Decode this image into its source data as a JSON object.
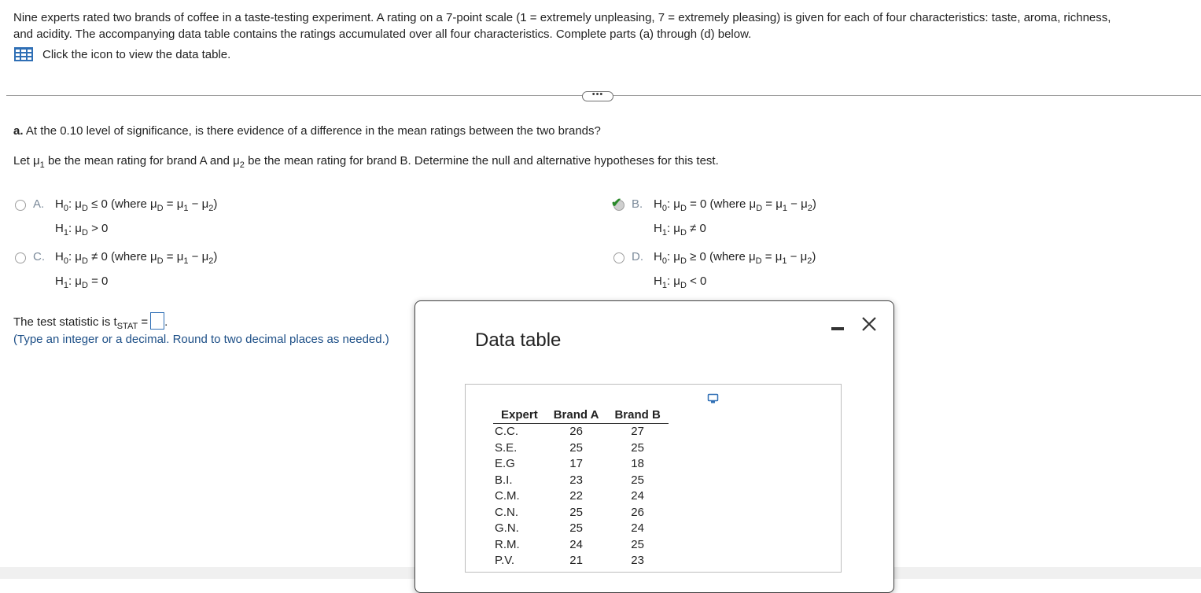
{
  "intro": {
    "line1": "Nine experts rated two brands of coffee in a taste-testing experiment. A rating on a 7-point scale (1 = extremely unpleasing, 7 = extremely pleasing) is given for each of four characteristics: taste, aroma, richness,",
    "line2": "and acidity. The accompanying data table contains the ratings accumulated over all four characteristics. Complete parts (a) through (d) below.",
    "link_text": "Click the icon to view the data table."
  },
  "more_button": "•••",
  "part_a": {
    "letter": "a.",
    "question": " At the 0.10 level of significance, is there evidence of a difference in the mean ratings between the two brands?",
    "let_line": {
      "t1": "Let μ",
      "s1": "1",
      "t2": " be the mean rating for brand A and μ",
      "s2": "2",
      "t3": " be the mean rating for brand B. Determine the null and alternative hypotheses for this test."
    },
    "options": [
      {
        "letter": "A.",
        "h0": "≤ 0",
        "h1": "> 0",
        "selected": false
      },
      {
        "letter": "B.",
        "h0": "= 0",
        "h1": "≠ 0",
        "selected": true
      },
      {
        "letter": "C.",
        "h0": "≠ 0",
        "h1": "= 0",
        "selected": false
      },
      {
        "letter": "D.",
        "h0": "≥ 0",
        "h1": "< 0",
        "selected": false
      }
    ],
    "where_text": " (where μ",
    "where_sub": "D",
    "where_rest": " = μ",
    "stat_label": "The test statistic is t",
    "stat_sub": "STAT",
    "stat_eq": " =",
    "stat_end": ".",
    "hint": "(Type an integer or a decimal. Round to two decimal places as needed.)"
  },
  "dialog": {
    "title": "Data table",
    "columns": [
      "Expert",
      "Brand A",
      "Brand B"
    ],
    "rows": [
      [
        "C.C.",
        "26",
        "27"
      ],
      [
        "S.E.",
        "25",
        "25"
      ],
      [
        "E.G",
        "17",
        "18"
      ],
      [
        "B.I.",
        "23",
        "25"
      ],
      [
        "C.M.",
        "22",
        "24"
      ],
      [
        "C.N.",
        "25",
        "26"
      ],
      [
        "G.N.",
        "25",
        "24"
      ],
      [
        "R.M.",
        "24",
        "25"
      ],
      [
        "P.V.",
        "21",
        "23"
      ]
    ]
  },
  "colors": {
    "accent_blue": "#2f6fb5",
    "hint_blue": "#1d4f87",
    "check_green": "#2a8a2a"
  }
}
